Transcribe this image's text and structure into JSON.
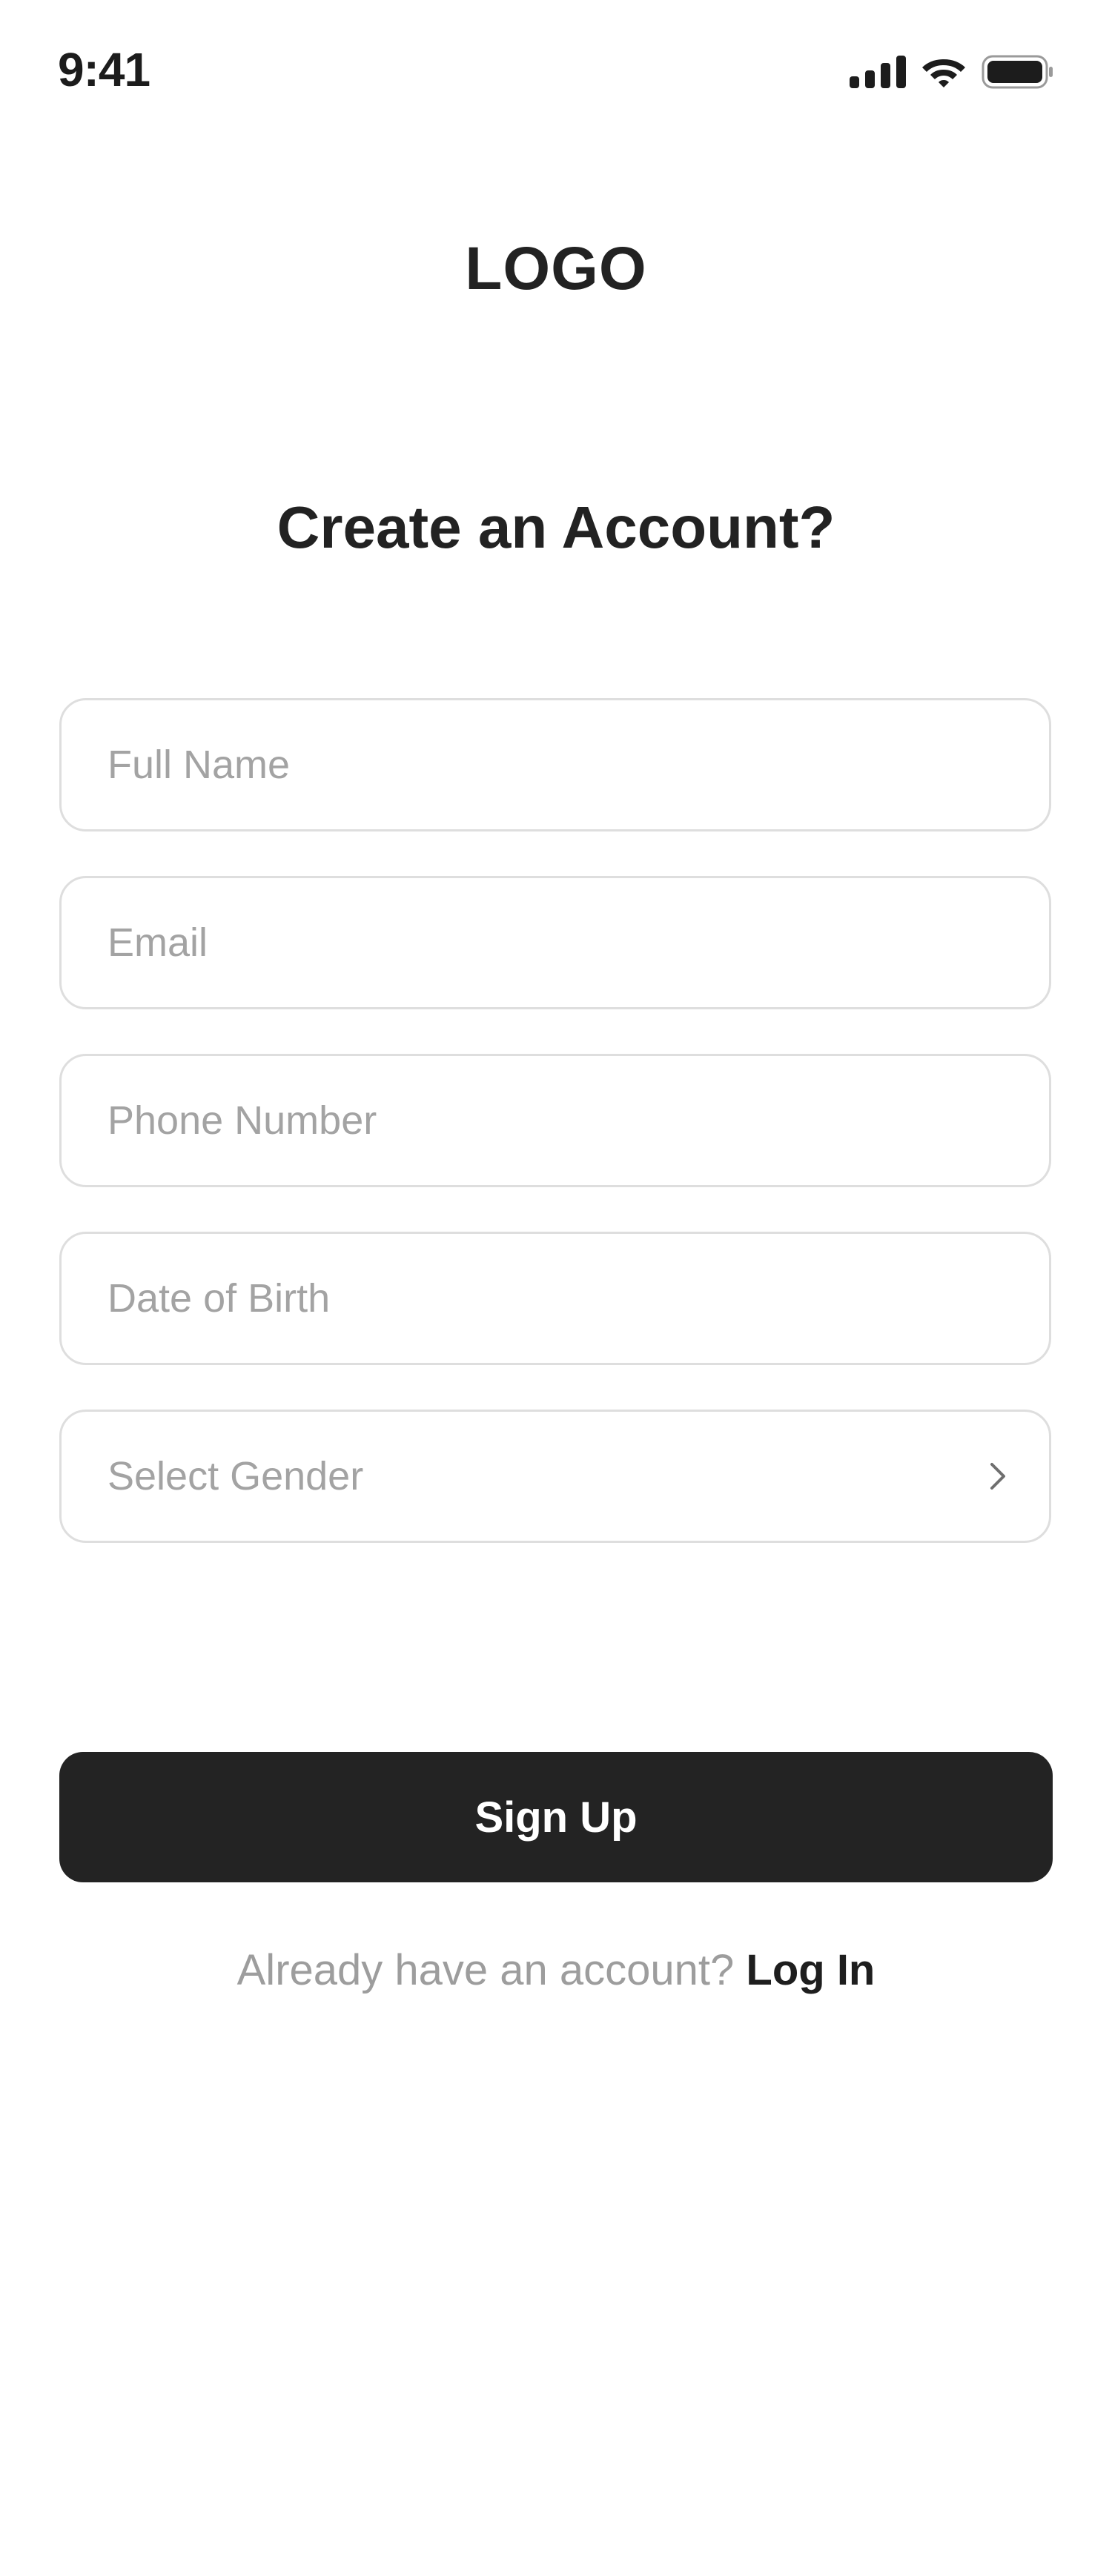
{
  "status_bar": {
    "time": "9:41",
    "icons": [
      "cellular-signal-icon",
      "wifi-icon",
      "battery-icon"
    ]
  },
  "header": {
    "logo": "LOGO",
    "title": "Create an Account?"
  },
  "form": {
    "full_name": {
      "placeholder": "Full Name",
      "value": ""
    },
    "email": {
      "placeholder": "Email",
      "value": ""
    },
    "phone": {
      "placeholder": "Phone Number",
      "value": ""
    },
    "dob": {
      "placeholder": "Date of Birth",
      "value": ""
    },
    "gender": {
      "label": "Select Gender",
      "icon": "chevron-right-icon"
    }
  },
  "actions": {
    "signup_label": "Sign Up",
    "login_prompt": "Already have an account?",
    "login_link": "Log In"
  },
  "colors": {
    "text_primary": "#222222",
    "placeholder": "#a3a3a3",
    "field_border": "#dedede",
    "button_bg": "#232323",
    "button_text": "#ffffff",
    "background": "#ffffff"
  }
}
